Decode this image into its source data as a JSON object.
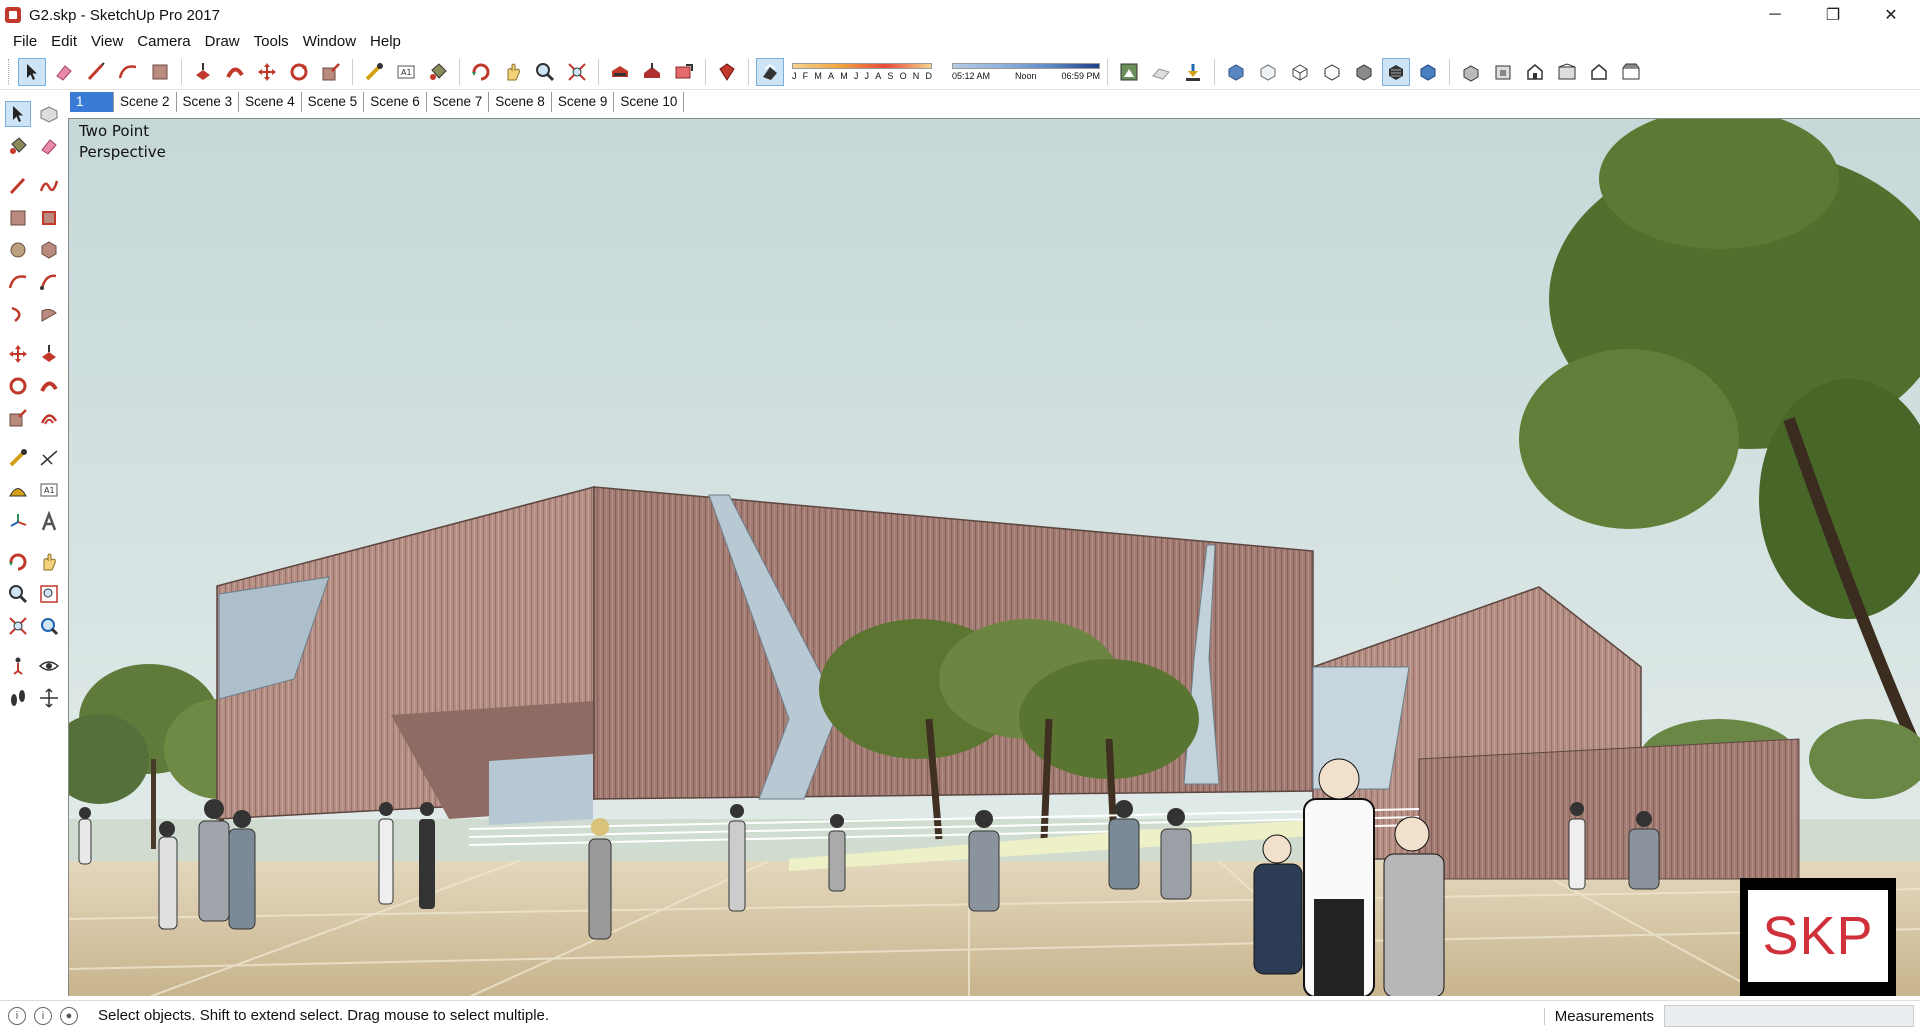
{
  "window": {
    "title": "G2.skp - SketchUp Pro 2017",
    "minimize": "─",
    "maximize": "❐",
    "close": "✕"
  },
  "menu": [
    "File",
    "Edit",
    "View",
    "Camera",
    "Draw",
    "Tools",
    "Window",
    "Help"
  ],
  "shadow": {
    "months": [
      "J",
      "F",
      "M",
      "A",
      "M",
      "J",
      "J",
      "A",
      "S",
      "O",
      "N",
      "D"
    ],
    "time_start": "05:12 AM",
    "time_noon": "Noon",
    "time_end": "06:59 PM"
  },
  "scenes": [
    "1",
    "Scene 2",
    "Scene 3",
    "Scene 4",
    "Scene 5",
    "Scene 6",
    "Scene 7",
    "Scene 8",
    "Scene 9",
    "Scene 10"
  ],
  "viewport": {
    "camera_label": "Two Point Perspective",
    "logo_text": "SKP"
  },
  "status": {
    "hint": "Select objects. Shift to extend select. Drag mouse to select multiple.",
    "measurements_label": "Measurements",
    "measurements_value": ""
  },
  "colors": {
    "accent": "#3a7bd5",
    "sky": "#d9e6e6",
    "ground": "#d3c2a0",
    "building": "#b28a80",
    "logo": "#d0303a"
  }
}
